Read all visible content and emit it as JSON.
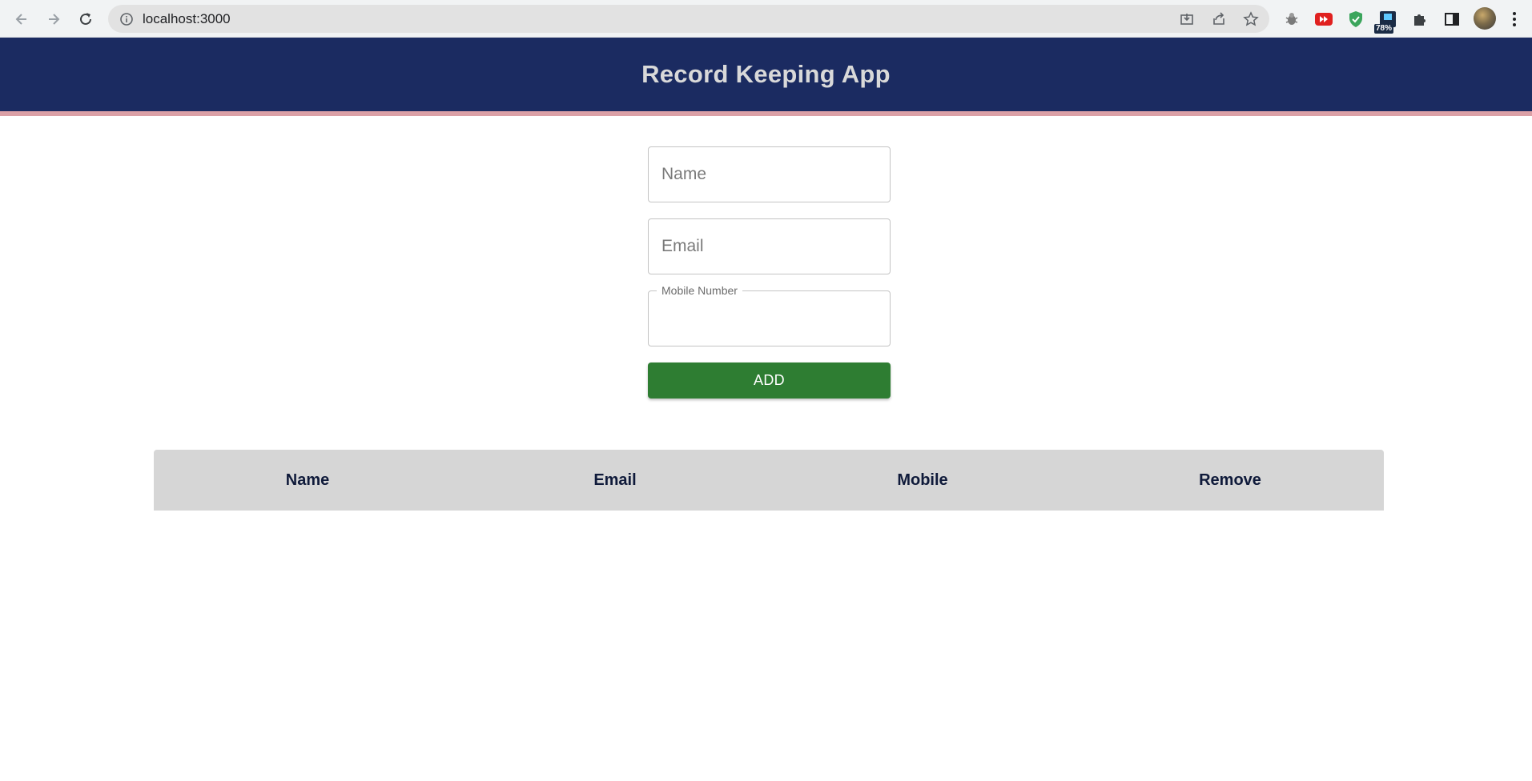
{
  "browser": {
    "url": "localhost:3000",
    "extensions": [
      {
        "icon": "bug-icon"
      },
      {
        "icon": "video-speed-icon"
      },
      {
        "icon": "shield-check-icon"
      },
      {
        "icon": "battery-extension-icon",
        "badge": "78%"
      },
      {
        "icon": "puzzle-icon"
      },
      {
        "icon": "side-panel-icon"
      }
    ],
    "colors": {
      "toolbar": "#f1f3f4",
      "omnibox": "#e2e2e2"
    }
  },
  "header": {
    "title": "Record Keeping App",
    "colors": {
      "background": "#1b2b61",
      "title": "#d9d9d9",
      "stripe": "#dba0a6"
    }
  },
  "form": {
    "name": {
      "placeholder": "Name",
      "value": ""
    },
    "email": {
      "placeholder": "Email",
      "value": ""
    },
    "mobile": {
      "label": "Mobile Number",
      "value": ""
    },
    "add_button": {
      "label": "ADD",
      "color": "#2e7d32"
    }
  },
  "table": {
    "columns": [
      "Name",
      "Email",
      "Mobile",
      "Remove"
    ],
    "rows": [],
    "header_color": "#d6d6d6"
  }
}
